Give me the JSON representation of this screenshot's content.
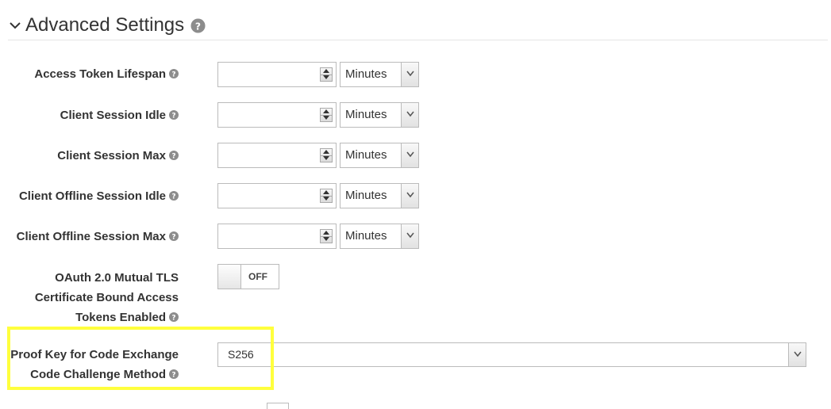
{
  "section": {
    "title": "Advanced Settings",
    "icons": {
      "collapse": "chevron-down-icon",
      "help": "question-circle-icon"
    }
  },
  "rows": [
    {
      "label": "Access Token Lifespan",
      "value": "",
      "unit": "Minutes"
    },
    {
      "label": "Client Session Idle",
      "value": "",
      "unit": "Minutes"
    },
    {
      "label": "Client Session Max",
      "value": "",
      "unit": "Minutes"
    },
    {
      "label": "Client Offline Session Idle",
      "value": "",
      "unit": "Minutes"
    },
    {
      "label": "Client Offline Session Max",
      "value": "",
      "unit": "Minutes"
    }
  ],
  "mtls": {
    "label_line1": "OAuth 2.0 Mutual TLS",
    "label_line2": "Certificate Bound Access",
    "label_line3": "Tokens Enabled",
    "state": "OFF"
  },
  "pkce": {
    "label_line1": "Proof Key for Code Exchange",
    "label_line2": "Code Challenge Method",
    "value": "S256"
  },
  "colors": {
    "highlight": "#ffff3d",
    "help_icon": "#8c8c8c"
  }
}
